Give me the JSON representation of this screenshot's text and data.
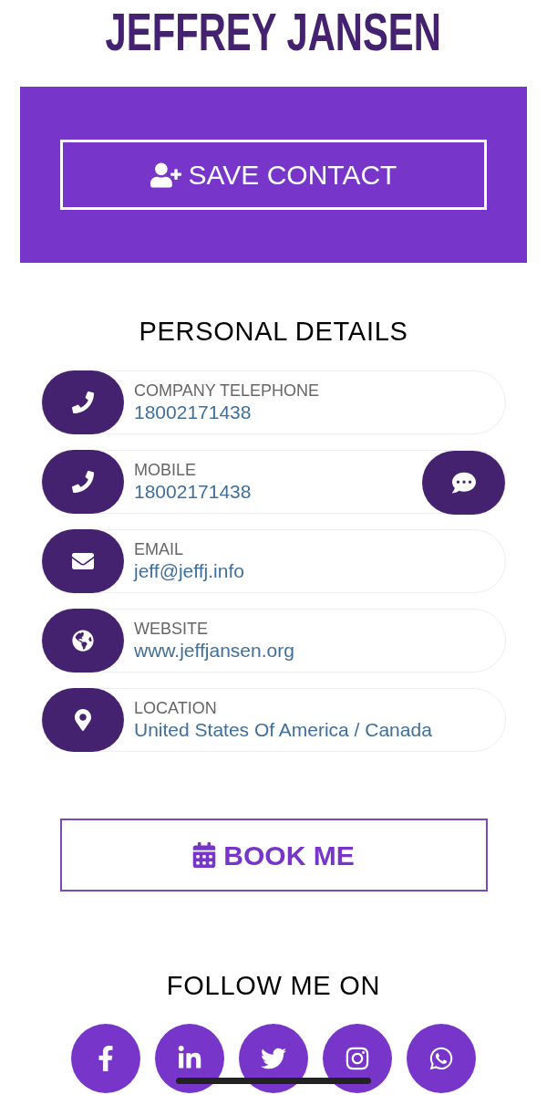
{
  "name": "JEFFREY JANSEN",
  "save_button": {
    "label": "SAVE CONTACT"
  },
  "section_title": "PERSONAL DETAILS",
  "details": [
    {
      "kind": "phone",
      "label": "COMPANY TELEPHONE",
      "value": "18002171438",
      "message_button": false
    },
    {
      "kind": "phone",
      "label": "MOBILE",
      "value": "18002171438",
      "message_button": true
    },
    {
      "kind": "email",
      "label": "EMAIL",
      "value": "jeff@jeffj.info",
      "message_button": false
    },
    {
      "kind": "website",
      "label": "WEBSITE",
      "value": "www.jeffjansen.org",
      "message_button": false
    },
    {
      "kind": "location",
      "label": "LOCATION",
      "value": "United States Of America / Canada",
      "message_button": false
    }
  ],
  "book_button": {
    "label": "BOOK ME"
  },
  "follow_title": "FOLLOW ME ON",
  "social": [
    {
      "kind": "facebook"
    },
    {
      "kind": "linkedin"
    },
    {
      "kind": "twitter"
    },
    {
      "kind": "instagram"
    },
    {
      "kind": "whatsapp"
    }
  ]
}
